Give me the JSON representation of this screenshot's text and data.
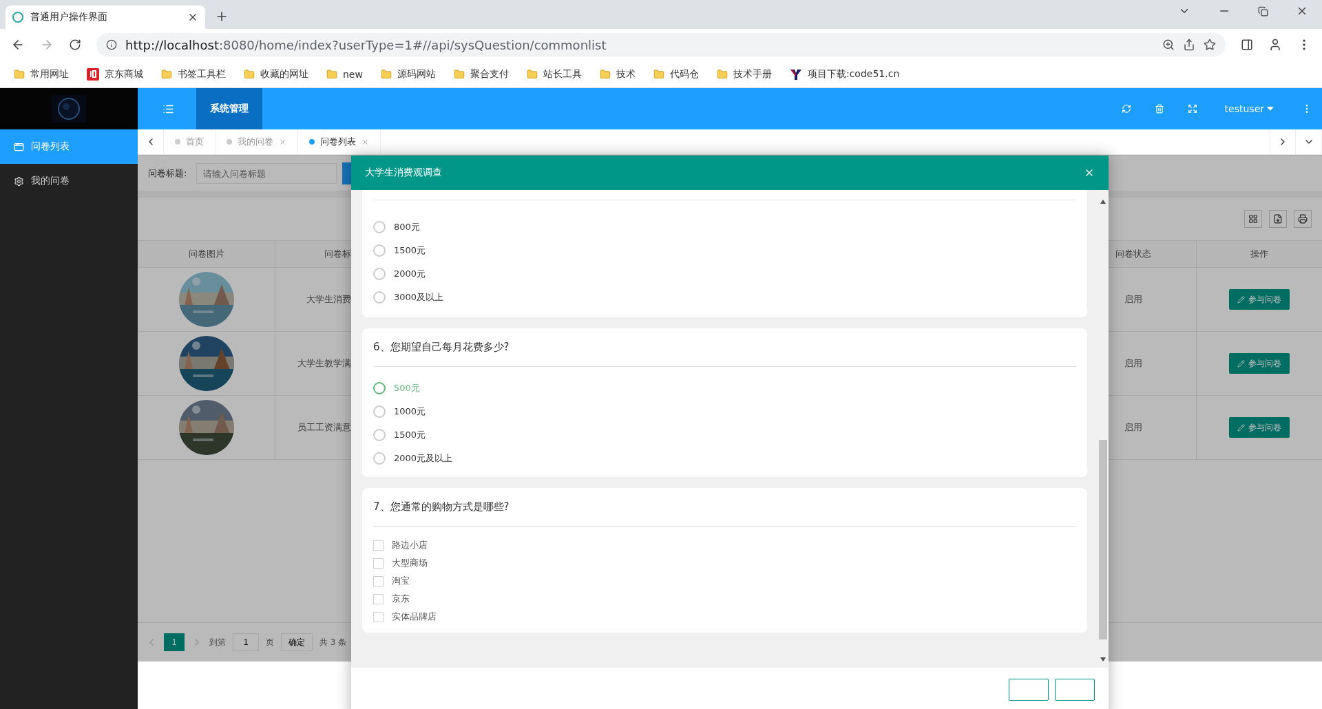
{
  "browser": {
    "tab_title": "普通用户操作界面",
    "url_host": "http://localhost",
    "url_rest": ":8080/home/index?userType=1#//api/sysQuestion/commonlist",
    "bookmarks": [
      {
        "label": "常用网址",
        "kind": "folder"
      },
      {
        "label": "京东商城",
        "kind": "shop"
      },
      {
        "label": "书签工具栏",
        "kind": "folder"
      },
      {
        "label": "收藏的网址",
        "kind": "folder"
      },
      {
        "label": "new",
        "kind": "folder"
      },
      {
        "label": "源码网站",
        "kind": "folder"
      },
      {
        "label": "聚合支付",
        "kind": "folder"
      },
      {
        "label": "站长工具",
        "kind": "folder"
      },
      {
        "label": "技术",
        "kind": "folder"
      },
      {
        "label": "代码仓",
        "kind": "folder"
      },
      {
        "label": "技术手册",
        "kind": "folder"
      },
      {
        "label": "项目下载:code51.cn",
        "kind": "download"
      }
    ]
  },
  "header": {
    "menu": "系统管理",
    "user": "testuser"
  },
  "sidebar": {
    "items": [
      {
        "label": "问卷列表",
        "selected": true
      },
      {
        "label": "我的问卷",
        "selected": false
      }
    ]
  },
  "tabs": [
    {
      "label": "首页",
      "closable": false,
      "selected": false
    },
    {
      "label": "我的问卷",
      "closable": true,
      "selected": false
    },
    {
      "label": "问卷列表",
      "closable": true,
      "selected": true
    }
  ],
  "search": {
    "label": "问卷标题:",
    "placeholder": "请输入问卷标题"
  },
  "table": {
    "columns": [
      "问卷图片",
      "问卷标",
      "问卷状态",
      "操作"
    ],
    "rows": [
      {
        "title": "大学生消费",
        "status": "启用",
        "action": "参与问卷"
      },
      {
        "title": "大学生教学满",
        "status": "启用",
        "action": "参与问卷"
      },
      {
        "title": "员工工资满意",
        "status": "启用",
        "action": "参与问卷"
      }
    ]
  },
  "pagination": {
    "page": "1",
    "goto_label": "到第",
    "goto_value": "1",
    "page_unit": "页",
    "confirm": "确定",
    "total": "共 3 条"
  },
  "dialog": {
    "title": "大学生消费观调查",
    "questions": [
      {
        "kind": "radio",
        "options": [
          {
            "label": "800元",
            "selected": false,
            "highlighted": false
          },
          {
            "label": "1500元",
            "selected": false,
            "highlighted": false
          },
          {
            "label": "2000元",
            "selected": false,
            "highlighted": false
          },
          {
            "label": "3000及以上",
            "selected": false,
            "highlighted": false
          }
        ]
      },
      {
        "kind": "radio",
        "title": "6、您期望自己每月花费多少?",
        "options": [
          {
            "label": "500元",
            "selected": false,
            "highlighted": true
          },
          {
            "label": "1000元",
            "selected": false,
            "highlighted": false
          },
          {
            "label": "1500元",
            "selected": false,
            "highlighted": false
          },
          {
            "label": "2000元及以上",
            "selected": false,
            "highlighted": false
          }
        ]
      },
      {
        "kind": "checkbox",
        "title": "7、您通常的购物方式是哪些?",
        "options": [
          {
            "label": "路边小店",
            "checked": false
          },
          {
            "label": "大型商场",
            "checked": false
          },
          {
            "label": "淘宝",
            "checked": false
          },
          {
            "label": "京东",
            "checked": false
          },
          {
            "label": "实体品牌店",
            "checked": false
          }
        ]
      }
    ]
  }
}
